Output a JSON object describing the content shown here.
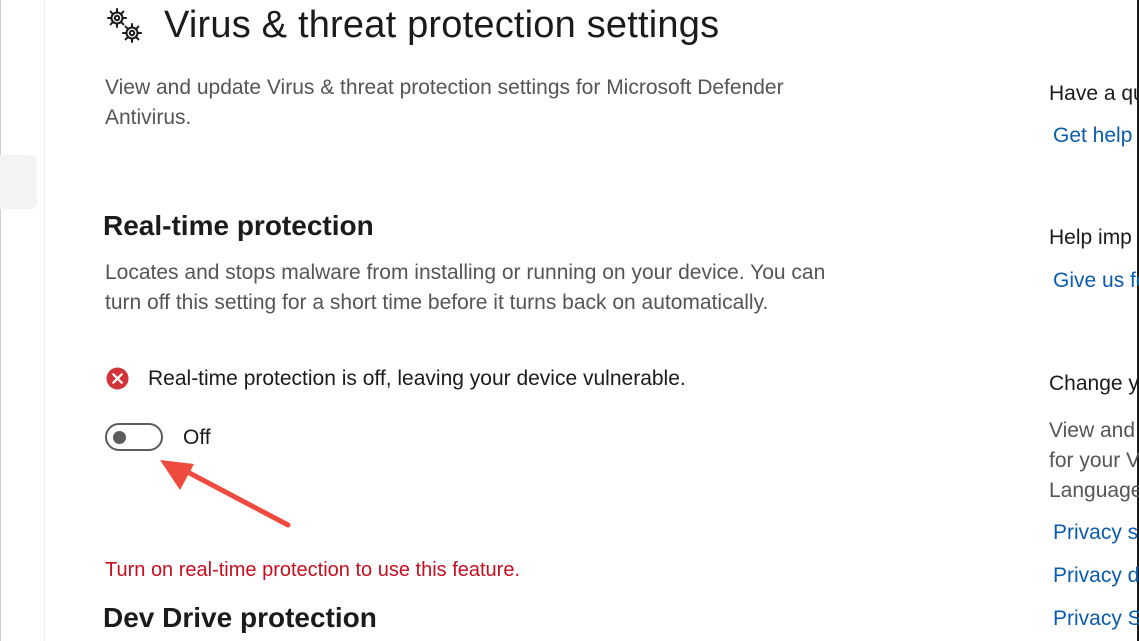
{
  "page": {
    "title": "Virus & threat protection settings",
    "description": "View and update Virus & threat protection settings for Microsoft Defender Antivirus."
  },
  "realtime": {
    "title": "Real-time protection",
    "description": "Locates and stops malware from installing or running on your device. You can turn off this setting for a short time before it turns back on automatically.",
    "status": "Real-time protection is off, leaving your device vulnerable.",
    "toggle_state": "Off",
    "toggle_on": false
  },
  "warning": "Turn on real-time protection to use this feature.",
  "devdrive": {
    "title": "Dev Drive protection"
  },
  "sidebar": {
    "question_heading": "Have a qu",
    "get_help": "Get help",
    "improve_heading": "Help imp",
    "give_feedback": "Give us fe",
    "privacy_heading": "Change y",
    "privacy_text": [
      "View and",
      "for your V",
      "Language"
    ],
    "privacy_links": [
      "Privacy se",
      "Privacy da",
      "Privacy St"
    ]
  },
  "colors": {
    "error": "#c50f1f",
    "error_icon": "#d13438",
    "link": "#0b5cad",
    "annotation_arrow": "#ee4a3e"
  },
  "icons": {
    "title_icon": "gear-icon",
    "status_icon": "error-icon",
    "annotation": "arrow-icon"
  }
}
